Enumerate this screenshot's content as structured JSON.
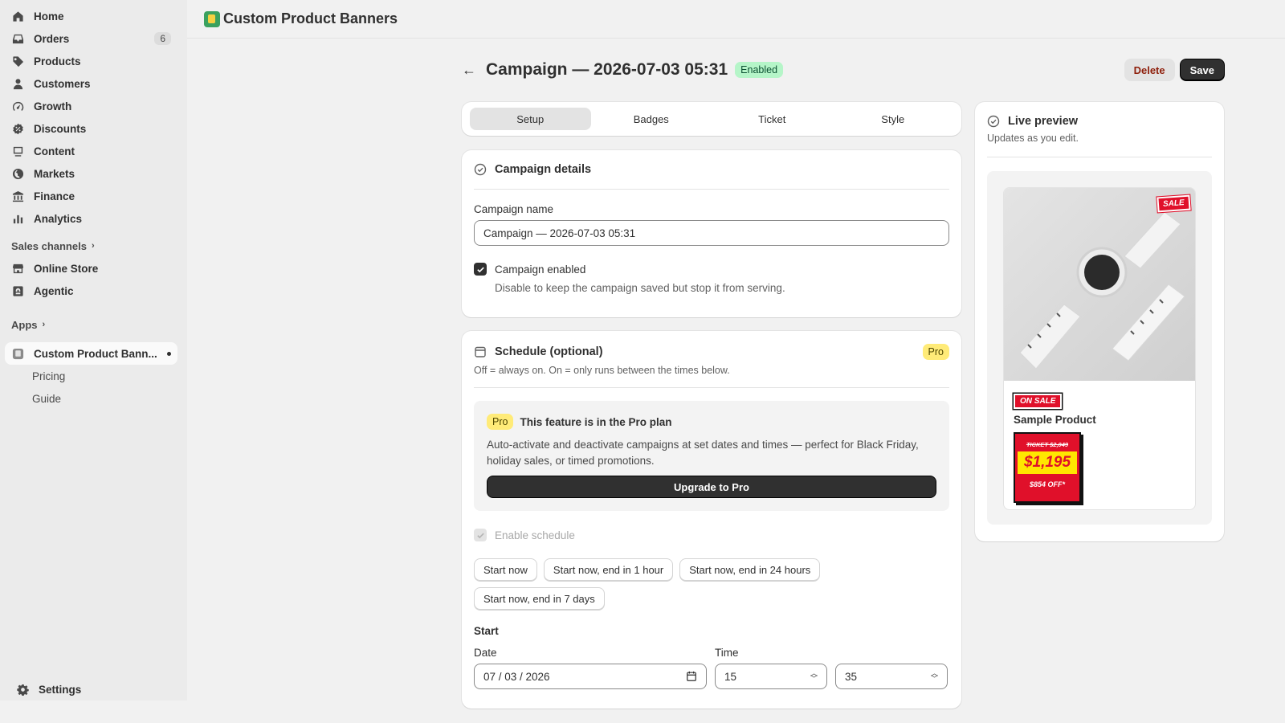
{
  "sidebar": {
    "items": [
      {
        "label": "Home",
        "icon": "home-icon"
      },
      {
        "label": "Orders",
        "icon": "inbox-icon",
        "count": "6"
      },
      {
        "label": "Products",
        "icon": "tag-icon"
      },
      {
        "label": "Customers",
        "icon": "person-icon"
      },
      {
        "label": "Growth",
        "icon": "gauge-icon"
      },
      {
        "label": "Discounts",
        "icon": "discount-icon"
      },
      {
        "label": "Content",
        "icon": "content-icon"
      },
      {
        "label": "Markets",
        "icon": "globe-icon"
      },
      {
        "label": "Finance",
        "icon": "bank-icon"
      },
      {
        "label": "Analytics",
        "icon": "bar-chart-icon"
      }
    ],
    "sales_channels_label": "Sales channels",
    "channels": [
      {
        "label": "Online Store",
        "icon": "store-icon"
      },
      {
        "label": "Agentic",
        "icon": "agentic-icon"
      }
    ],
    "apps_label": "Apps",
    "app": {
      "label": "Custom Product Bann...",
      "icon": "app-icon"
    },
    "app_subitems": [
      "Pricing",
      "Guide"
    ],
    "settings_label": "Settings"
  },
  "topbar": {
    "app_title": "Custom Product Banners"
  },
  "header": {
    "title": "Campaign — 2026-07-03 05:31",
    "status_badge": "Enabled",
    "delete_label": "Delete",
    "save_label": "Save"
  },
  "tabs": [
    "Setup",
    "Badges",
    "Ticket",
    "Style"
  ],
  "details": {
    "title": "Campaign details",
    "name_label": "Campaign name",
    "name_value": "Campaign — 2026-07-03 05:31",
    "enabled_label": "Campaign enabled",
    "enabled_help": "Disable to keep the campaign saved but stop it from serving."
  },
  "schedule": {
    "title": "Schedule (optional)",
    "badge": "Pro",
    "subtitle": "Off = always on. On = only runs between the times below.",
    "pro_box": {
      "badge": "Pro",
      "title": "This feature is in the Pro plan",
      "text": "Auto-activate and deactivate campaigns at set dates and times — perfect for Black Friday, holiday sales, or timed promotions.",
      "button": "Upgrade to Pro"
    },
    "enable_label": "Enable schedule",
    "quick_buttons": [
      "Start now",
      "Start now, end in 1 hour",
      "Start now, end in 24 hours",
      "Start now, end in 7 days"
    ],
    "start_label": "Start",
    "date_label": "Date",
    "date_value": "07 / 03 / 2026",
    "time_label": "Time",
    "hour_value": "15",
    "minute_value": "35"
  },
  "preview": {
    "title": "Live preview",
    "subtitle": "Updates as you edit.",
    "sale_tag": "SALE",
    "on_sale": "ON SALE",
    "product_name": "Sample Product",
    "ticket_top": "TICKET $2,049",
    "ticket_price": "$1,195",
    "ticket_bottom": "$854 OFF*"
  },
  "colors": {
    "accent_dark": "#303030",
    "enabled_bg": "#b5f5c8",
    "pro_bg": "#ffeb78",
    "sale_red": "#e0102a",
    "ticket_yellow": "#ffe600"
  }
}
